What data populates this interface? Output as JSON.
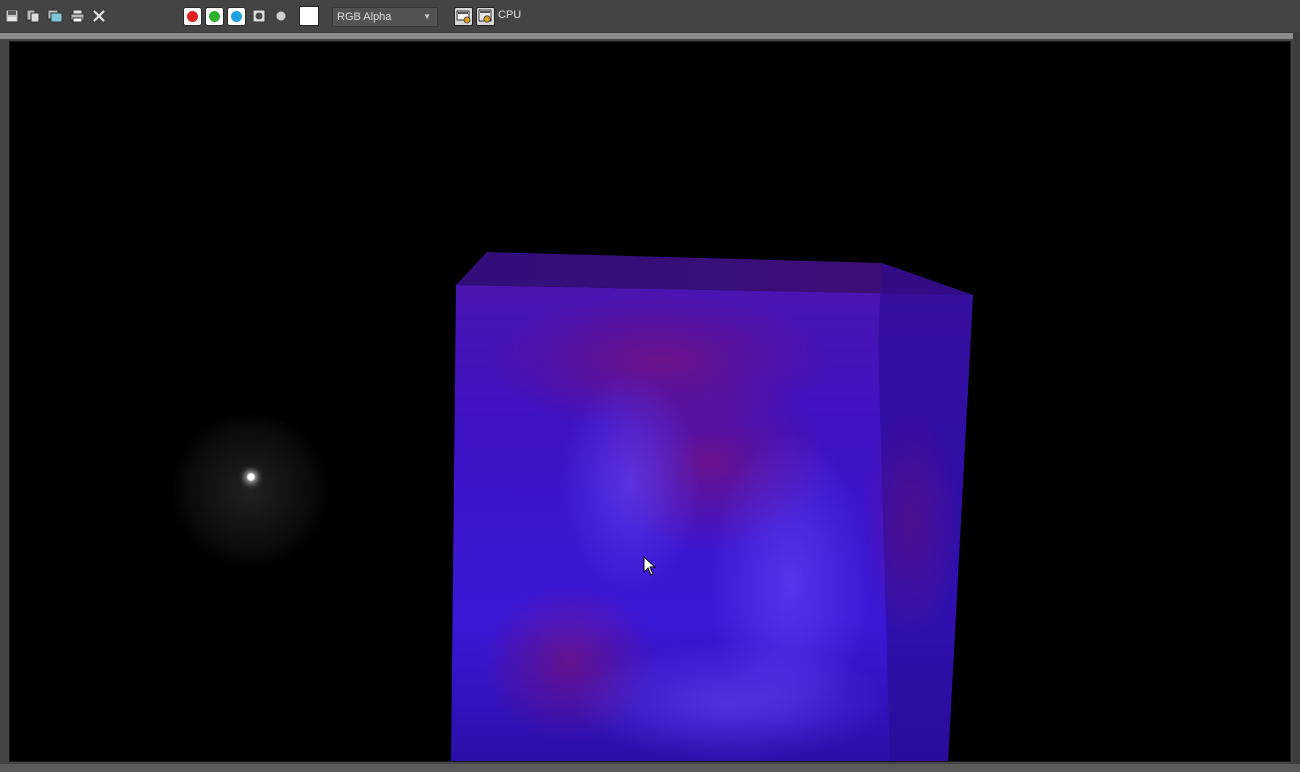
{
  "toolbar": {
    "buttons": [
      {
        "name": "save-image-icon"
      },
      {
        "name": "clone-window-icon"
      },
      {
        "name": "copy-image-icon"
      },
      {
        "name": "print-icon"
      },
      {
        "name": "clear-icon"
      }
    ],
    "channels": [
      {
        "name": "red-channel",
        "color": "#e02020"
      },
      {
        "name": "green-channel",
        "color": "#2fb02f"
      },
      {
        "name": "blue-channel",
        "color": "#1f9ee0"
      }
    ],
    "display_channel": "RGB Alpha",
    "swatch_color": "#ffffff",
    "cpu_label": "CPU"
  },
  "viewport": {
    "background": "#000000",
    "cube_color": "#3a10c8",
    "light_color": "#ffffff"
  }
}
